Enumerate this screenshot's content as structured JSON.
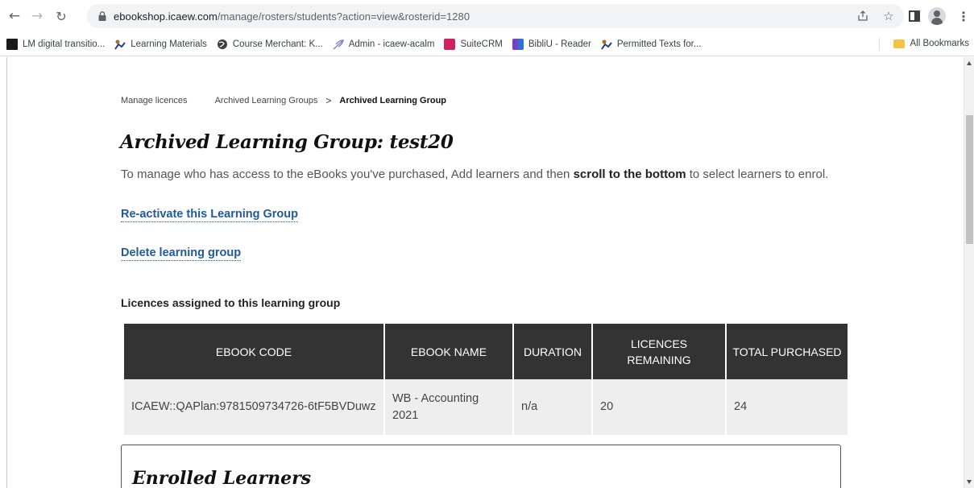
{
  "browser": {
    "url_host": "ebookshop.icaew.com",
    "url_path": "/manage/rosters/students?action=view&rosterid=1280",
    "bookmarks": [
      {
        "label": "LM digital transitio...",
        "color": "#1a1a1a"
      },
      {
        "label": "Learning Materials",
        "color": "#b06a2a"
      },
      {
        "label": "Course Merchant: K...",
        "color": "#3c4043"
      },
      {
        "label": "Admin - icaew-acalm",
        "color": "#7c88c8"
      },
      {
        "label": "SuiteCRM",
        "color": "#d0215f"
      },
      {
        "label": "BibliU - Reader",
        "color": "#7b3fbf"
      },
      {
        "label": "Permitted Texts for...",
        "color": "#b06a2a"
      }
    ],
    "all_bookmarks": "All Bookmarks"
  },
  "breadcrumb": {
    "item1": "Manage licences",
    "item2": "Archived Learning Groups",
    "separator": ">",
    "current": "Archived Learning Group"
  },
  "page": {
    "title": "Archived Learning Group: test20",
    "intro_pre": "To manage who has access to the eBooks you've purchased, Add learners and then ",
    "intro_bold": "scroll to the bottom",
    "intro_post": " to select learners to enrol.",
    "reactivate_link": "Re-activate this Learning Group",
    "delete_link": "Delete learning group",
    "licences_heading": "Licences assigned to this learning group"
  },
  "table": {
    "headers": [
      "EBOOK CODE",
      "EBOOK NAME",
      "DURATION",
      "LICENCES REMAINING",
      "TOTAL PURCHASED"
    ],
    "rows": [
      [
        "ICAEW::QAPlan:9781509734726-6tF5BVDuwz",
        "WB - Accounting 2021",
        "n/a",
        "20",
        "24"
      ]
    ]
  },
  "enrolled": {
    "title": "Enrolled Learners"
  },
  "colors": {
    "link": "#1f5a9a",
    "table_header_bg": "#333333",
    "table_cell_bg": "#eeeeee"
  }
}
